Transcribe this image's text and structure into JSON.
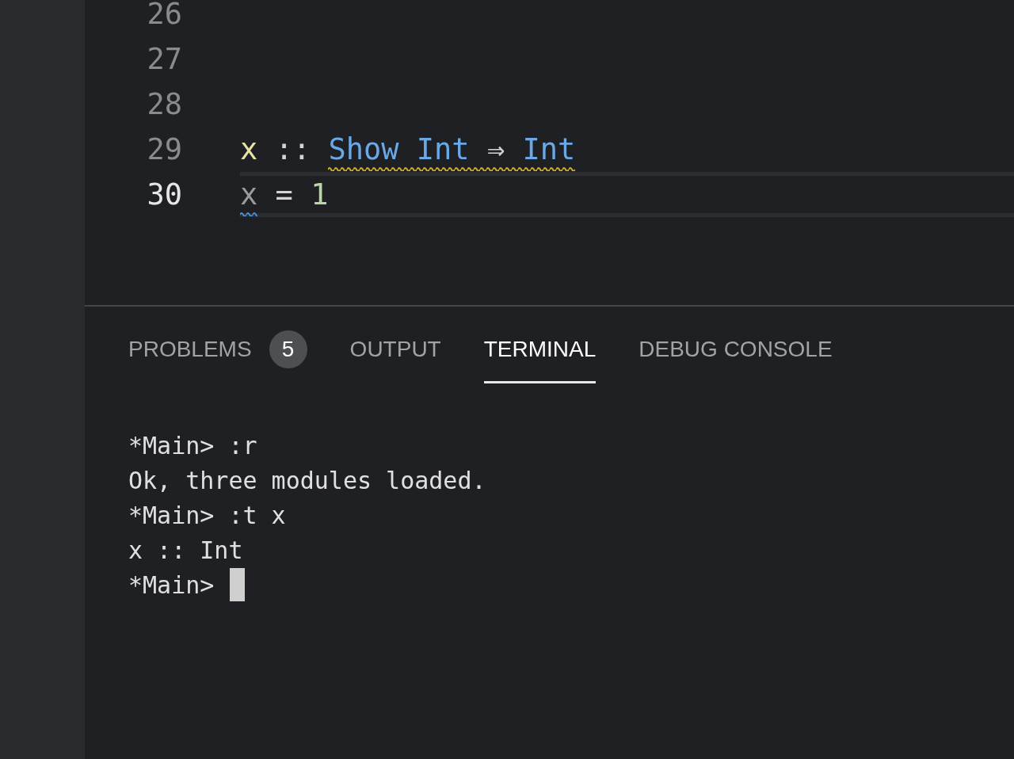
{
  "editor": {
    "lines": [
      {
        "number": "26",
        "current": false
      },
      {
        "number": "27",
        "current": false
      },
      {
        "number": "28",
        "current": false
      },
      {
        "number": "29",
        "current": false,
        "tokens": [
          {
            "text": "x",
            "kind": "variable"
          },
          {
            "text": "::",
            "kind": "operator"
          },
          {
            "kind": "warning",
            "tokens": [
              {
                "text": "Show",
                "kind": "type"
              },
              {
                "text": "Int",
                "kind": "type"
              },
              {
                "text": "⇒",
                "kind": "operator"
              },
              {
                "text": "Int",
                "kind": "type"
              }
            ]
          }
        ]
      },
      {
        "number": "30",
        "current": true,
        "tokens": [
          {
            "kind": "info",
            "tokens": [
              {
                "text": "x",
                "kind": "unused"
              }
            ]
          },
          {
            "text": "=",
            "kind": "operator"
          },
          {
            "text": "1",
            "kind": "number"
          }
        ]
      }
    ]
  },
  "panel": {
    "tabs": [
      {
        "label": "PROBLEMS",
        "selected": false,
        "badge": "5"
      },
      {
        "label": "OUTPUT",
        "selected": false
      },
      {
        "label": "TERMINAL",
        "selected": true
      },
      {
        "label": "DEBUG CONSOLE",
        "selected": false
      }
    ],
    "terminal": {
      "lines": [
        "*Main> :r",
        "Ok, three modules loaded.",
        "*Main> :t x",
        "x :: Int",
        "*Main> "
      ],
      "cursor_visible": true
    }
  }
}
